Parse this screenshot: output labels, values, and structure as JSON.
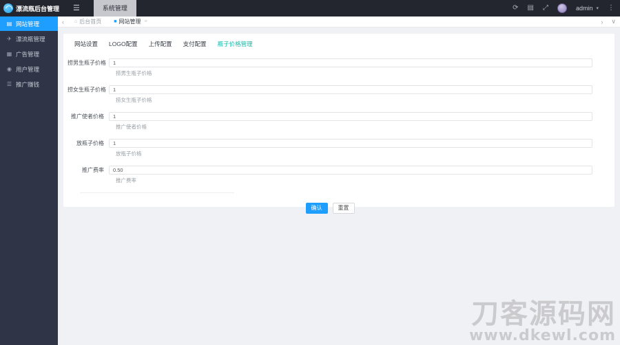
{
  "app": {
    "title": "漂流瓶后台管理"
  },
  "header": {
    "menu_icon": "☰",
    "nav_tab": "系统管理",
    "refresh_icon": "⟳",
    "grid_icon": "▤",
    "fullscreen_icon": "⤢",
    "username": "admin",
    "caret_icon": "▾",
    "more_icon": "⋮"
  },
  "tabbar": {
    "back_icon": "‹",
    "forward_icon": "›",
    "dropdown_icon": "∨",
    "tabs": [
      {
        "label": "后台首页",
        "icon": "⌂"
      },
      {
        "label": "网站管理",
        "icon": "■",
        "close": "×"
      }
    ]
  },
  "sidebar": {
    "items": [
      {
        "label": "网站管理",
        "icon": "▤"
      },
      {
        "label": "漂流瓶管理",
        "icon": "✈"
      },
      {
        "label": "广告管理",
        "icon": "▦"
      },
      {
        "label": "用户管理",
        "icon": "◉"
      },
      {
        "label": "推广赚钱",
        "icon": "☰"
      }
    ]
  },
  "content": {
    "tabs": [
      {
        "label": "网站设置"
      },
      {
        "label": "LOGO配置"
      },
      {
        "label": "上传配置"
      },
      {
        "label": "支付配置"
      },
      {
        "label": "瓶子价格管理"
      }
    ],
    "form": {
      "rows": [
        {
          "label": "捞男生瓶子价格",
          "value": "1",
          "hint": "捞男生瓶子价格"
        },
        {
          "label": "捞女生瓶子价格",
          "value": "1",
          "hint": "捞女生瓶子价格"
        },
        {
          "label": "推广使者价格",
          "value": "1",
          "hint": "推广使者价格"
        },
        {
          "label": "放瓶子价格",
          "value": "1",
          "hint": "放瓶子价格"
        },
        {
          "label": "推广费率",
          "value": "0.50",
          "hint": "推广费率"
        }
      ]
    },
    "buttons": {
      "confirm": "确认",
      "reset": "重置"
    }
  },
  "watermark": {
    "line1": "刀客源码网",
    "line2": "www.dkewl.com"
  },
  "colors": {
    "accent_blue": "#1e9fff",
    "tab_active_teal": "#16baaa",
    "header_bg": "#23262e",
    "sidebar_bg": "#2f3447"
  }
}
